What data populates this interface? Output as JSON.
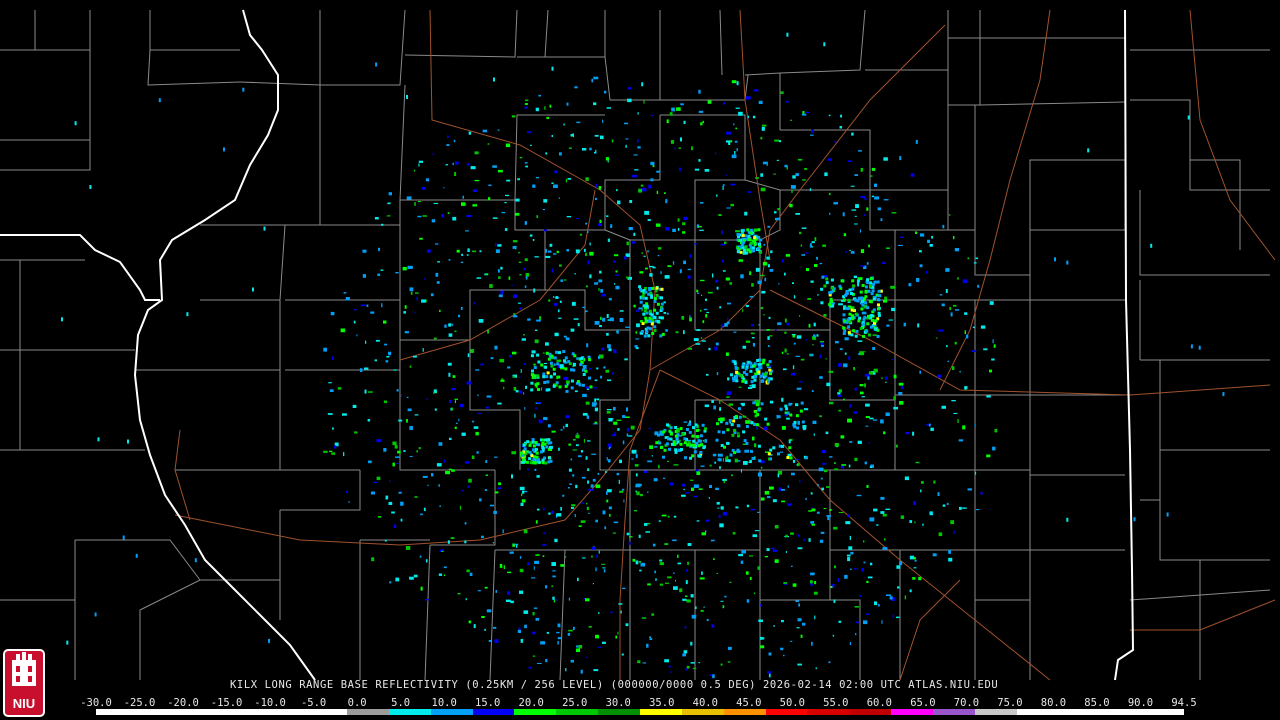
{
  "caption": "KILX LONG RANGE BASE REFLECTIVITY (0.25KM / 256 LEVEL) (000000/0000 0.5 DEG) 2026-02-14 02:00 UTC  ATLAS.NIU.EDU",
  "logo_text": "NIU",
  "colorbar": {
    "ticks": [
      "-30.0",
      "-25.0",
      "-20.0",
      "-15.0",
      "-10.0",
      "-5.0",
      "0.0",
      "5.0",
      "10.0",
      "15.0",
      "20.0",
      "25.0",
      "30.0",
      "35.0",
      "40.0",
      "45.0",
      "50.0",
      "55.0",
      "60.0",
      "65.0",
      "70.0",
      "75.0",
      "80.0",
      "85.0",
      "90.0",
      "94.5"
    ],
    "colors": [
      "#ffffff",
      "#ffffff",
      "#ffffff",
      "#ffffff",
      "#ffffff",
      "#ffffff",
      "#9c9c9c",
      "#00ecec",
      "#01a0f6",
      "#0000f6",
      "#00ff00",
      "#00c800",
      "#009000",
      "#ffff00",
      "#e7c000",
      "#ff9000",
      "#ff0000",
      "#d60000",
      "#c00000",
      "#ff00ff",
      "#9955c9",
      "#c8c8c8",
      "#ffffff",
      "#ffffff",
      "#ffffff",
      "#ffffff"
    ]
  },
  "colors": {
    "background": "#000000",
    "county_lines": "#8a8a8a",
    "state_lines": "#ffffff",
    "roads": "#a0522d"
  }
}
